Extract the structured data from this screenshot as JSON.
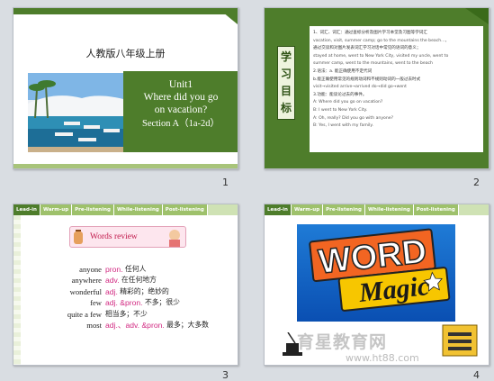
{
  "slides": [
    {
      "number": "1",
      "textbook": "人教版八年级上册",
      "unit": "Unit1",
      "title_line1": "Where did you go",
      "title_line2": "on vacation?",
      "section": "Section A（1a-2d）"
    },
    {
      "number": "2",
      "label_chars": [
        "学",
        "习",
        "目",
        "标"
      ],
      "lines": [
        "1、词汇、词汇：通过查标分析及图片学习本堂及习图等学词汇",
        "vacation, visit, summer camp; go to the mountains the beach...，",
        "通过交谈和对图片发表词汇学习对话中常见的语词的意义；",
        "stayed at home, went to New York City, visited my uncle, went to",
        "summer camp, went to the mountains, went to the beach",
        "2.语法：a. 能正确使用不定代词",
        "b.能正确使用常见的规则动词和不规则动词的一般过去时式",
        "visit→visited arrive→arrived do→did go→went",
        "3.功能：能谈论过去的事件。",
        "A: Where did you go on vacation?",
        "B: I went to New York City.",
        "A: Oh, really? Did you go with anyone?",
        "B: Yes, I went with my family."
      ]
    },
    {
      "number": "3",
      "tabs": [
        "Lead-in",
        "Warm-up",
        "Pre-listening",
        "While-listening",
        "Post-listening"
      ],
      "review_title": "Words review",
      "vocab": [
        {
          "en": "anyone",
          "pos": "pron.",
          "zh": "任何人"
        },
        {
          "en": "anywhere",
          "pos": "adv.",
          "zh": "在任何地方"
        },
        {
          "en": "wonderful",
          "pos": "adj.",
          "zh": "精彩的；绝妙的"
        },
        {
          "en": "few",
          "pos": "adj. &pron.",
          "zh": "不多；很少"
        },
        {
          "en": "quite a few",
          "pos": "",
          "zh": "相当多；不少"
        },
        {
          "en": "most",
          "pos": "adj.、adv. &pron.",
          "zh": "最多；大多数"
        }
      ]
    },
    {
      "number": "4",
      "tabs": [
        "Lead-in",
        "Warm-up",
        "Pre-listening",
        "While-listening",
        "Post-listening"
      ],
      "logo_word": "WORD",
      "logo_magic": "Magic",
      "watermark": "育星教育网",
      "watermark_url": "www.ht88.com"
    }
  ],
  "colors": {
    "green": "#4e7d2b",
    "light_green": "#9ec16b",
    "pink_text": "#d22a82",
    "blue_logo": "#1f7bd6",
    "orange_word": "#f26522",
    "gold_magic": "#f7c600"
  }
}
